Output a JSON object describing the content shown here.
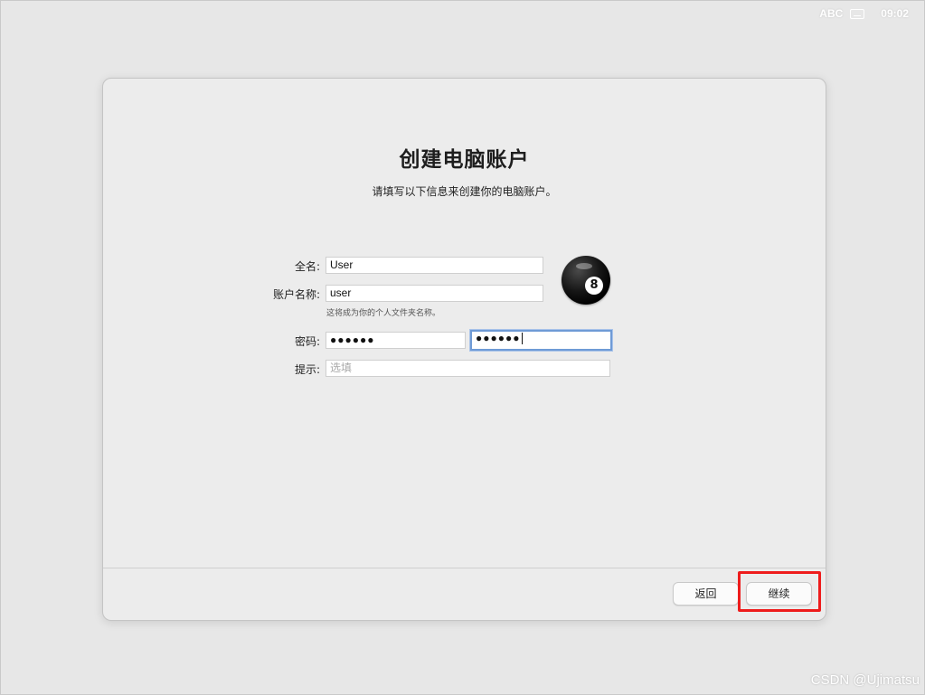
{
  "menubar": {
    "input_source": "ABC",
    "input_icon": "keyboard-icon",
    "time": "09:02"
  },
  "setup": {
    "title": "创建电脑账户",
    "subtitle": "请填写以下信息来创建你的电脑账户。",
    "full_name": {
      "label": "全名:",
      "value": "User"
    },
    "account_name": {
      "label": "账户名称:",
      "value": "user",
      "helper": "这将成为你的个人文件夹名称。"
    },
    "password": {
      "label": "密码:",
      "value": "●●●●●●",
      "verify_value": "●●●●●●"
    },
    "hint": {
      "label": "提示:",
      "placeholder": "选填"
    },
    "avatar": {
      "icon": "eight-ball-icon",
      "number": "8"
    },
    "buttons": {
      "back": "返回",
      "continue": "继续"
    }
  },
  "annotation": {
    "highlight_color": "#ee1c1c"
  },
  "watermark": "CSDN @Ujimatsu"
}
